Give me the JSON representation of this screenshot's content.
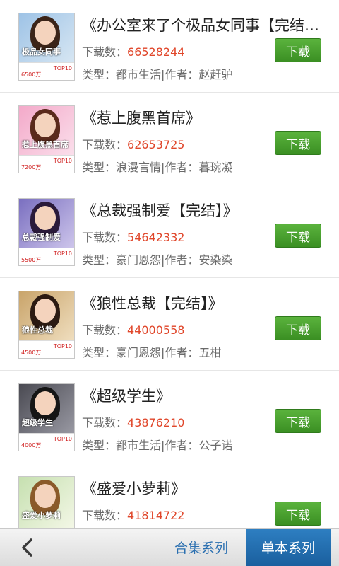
{
  "labels": {
    "downloads_prefix": "下载数：",
    "type_prefix": "类型：",
    "author_prefix": "作者：",
    "separator": "|",
    "download_button": "下载"
  },
  "books": [
    {
      "title": "《办公室来了个极品女同事【完结】》",
      "downloads": "66528244",
      "type": "都市生活",
      "author": "赵赶驴",
      "cover_text": "极品女同事",
      "cover_count": "6500万",
      "cover_colors": [
        "#9ec3e6",
        "#d8e7f3"
      ],
      "hair_color": "#3b2418"
    },
    {
      "title": "《惹上腹黑首席》",
      "downloads": "62653725",
      "type": "浪漫言情",
      "author": "暮琬凝",
      "cover_text": "惹上腹黑首席",
      "cover_count": "7200万",
      "cover_colors": [
        "#f3a9c9",
        "#fbe0ec"
      ],
      "hair_color": "#5a2a1c"
    },
    {
      "title": "《总裁强制爱【完结】》",
      "downloads": "54642332",
      "type": "豪门恩怨",
      "author": "安染染",
      "cover_text": "总裁强制爱",
      "cover_count": "5500万",
      "cover_colors": [
        "#7a6fc0",
        "#cfc7ec"
      ],
      "hair_color": "#2a1a3a"
    },
    {
      "title": "《狼性总裁【完结】》",
      "downloads": "44000558",
      "type": "豪门恩怨",
      "author": "五柑",
      "cover_text": "狼性总裁",
      "cover_count": "4500万",
      "cover_colors": [
        "#c9a46a",
        "#f0dfc0"
      ],
      "hair_color": "#2b1a12"
    },
    {
      "title": "《超级学生》",
      "downloads": "43876210",
      "type": "都市生活",
      "author": "公子诺",
      "cover_text": "超级学生",
      "cover_count": "4000万",
      "cover_colors": [
        "#4a4a52",
        "#9a9aa4"
      ],
      "hair_color": "#151515"
    },
    {
      "title": "《盛爱小萝莉》",
      "downloads": "41814722",
      "type": "",
      "author": "",
      "cover_text": "盛爱小萝莉",
      "cover_count": "",
      "cover_colors": [
        "#c6e0b0",
        "#f3f7e6"
      ],
      "hair_color": "#8a5a2a"
    }
  ],
  "bottom_bar": {
    "tab_collection": "合集系列",
    "tab_single": "单本系列"
  }
}
